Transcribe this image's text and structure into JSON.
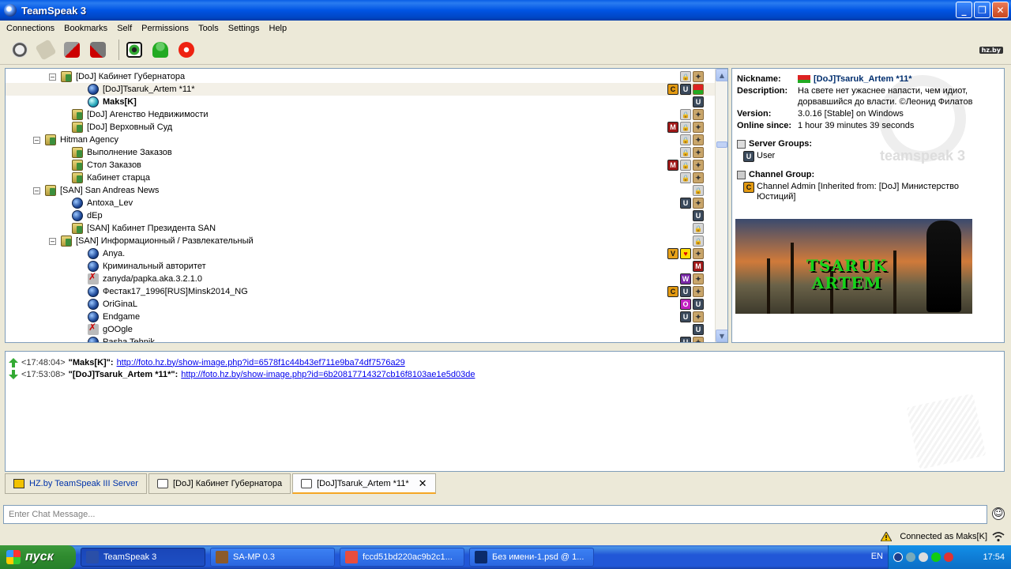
{
  "window": {
    "title": "TeamSpeak 3"
  },
  "menu": [
    "Connections",
    "Bookmarks",
    "Self",
    "Permissions",
    "Tools",
    "Settings",
    "Help"
  ],
  "toolbar": {
    "buttons": [
      "connect-icon",
      "bookmark-icon",
      "disconnect-icon",
      "disconnect-all-icon",
      "away-icon",
      "identity-icon",
      "contact-icon",
      "record-icon"
    ],
    "hz_logo": "hz.by"
  },
  "tree": [
    {
      "label": "[DoJ] Кабинет Губернатора",
      "type": "channel",
      "indent": 70,
      "expander": "–",
      "badges": [
        "lock",
        "misc"
      ]
    },
    {
      "label": "[DoJ]Tsaruk_Artem *11*",
      "type": "user",
      "indent": 104,
      "selected": true,
      "badges": [
        "C",
        "U",
        "flag"
      ]
    },
    {
      "label": "Maks[K]",
      "type": "user-talk",
      "indent": 104,
      "bold": true,
      "badges": [
        "U"
      ]
    },
    {
      "label": "[DoJ] Агенство Недвижимости",
      "type": "channel",
      "indent": 84,
      "badges": [
        "lock",
        "misc"
      ]
    },
    {
      "label": "[DoJ] Верховный Суд",
      "type": "channel",
      "indent": 84,
      "badges": [
        "M",
        "lock",
        "misc"
      ]
    },
    {
      "label": "Hitman Agency",
      "type": "channel",
      "indent": 50,
      "expander": "–",
      "badges": [
        "lock",
        "misc"
      ]
    },
    {
      "label": "Выполнение Заказов",
      "type": "channel",
      "indent": 84,
      "badges": [
        "lock",
        "misc"
      ]
    },
    {
      "label": "Стол Заказов",
      "type": "channel",
      "indent": 84,
      "badges": [
        "M",
        "lock",
        "misc"
      ]
    },
    {
      "label": "Кабинет старца",
      "type": "channel",
      "indent": 84,
      "badges": [
        "lock",
        "misc"
      ]
    },
    {
      "label": "[SAN] San Andreas News",
      "type": "channel",
      "indent": 50,
      "expander": "–",
      "badges": [
        "lock"
      ]
    },
    {
      "label": "Antoxa_Lev",
      "type": "user",
      "indent": 84,
      "badges": [
        "U",
        "misc"
      ]
    },
    {
      "label": "dEp",
      "type": "user",
      "indent": 84,
      "badges": [
        "U"
      ]
    },
    {
      "label": "[SAN] Кабинет Президента SAN",
      "type": "channel",
      "indent": 84,
      "badges": [
        "lock"
      ]
    },
    {
      "label": "[SAN] Информационный / Развлекательный",
      "type": "channel",
      "indent": 70,
      "expander": "–",
      "badges": [
        "lock"
      ]
    },
    {
      "label": "Anya.",
      "type": "user",
      "indent": 104,
      "badges": [
        "V",
        "heart",
        "misc"
      ]
    },
    {
      "label": "Криминальный авторитет",
      "type": "user",
      "indent": 104,
      "badges": [
        "M"
      ]
    },
    {
      "label": "zanyda/papka.aka.3.2.1.0",
      "type": "away",
      "indent": 104,
      "badges": [
        "W",
        "misc"
      ]
    },
    {
      "label": "Фестак17_1996[RUS]Minsk2014_NG",
      "type": "user",
      "indent": 104,
      "badges": [
        "C",
        "U",
        "misc"
      ]
    },
    {
      "label": "OriGinaL",
      "type": "user",
      "indent": 104,
      "badges": [
        "O",
        "U"
      ]
    },
    {
      "label": "Endgame",
      "type": "user",
      "indent": 104,
      "badges": [
        "U",
        "misc"
      ]
    },
    {
      "label": "gOOgle",
      "type": "away",
      "indent": 104,
      "badges": [
        "U"
      ]
    },
    {
      "label": "Pasha Tehnik",
      "type": "user",
      "indent": 104,
      "badges": [
        "U",
        "misc"
      ]
    }
  ],
  "info": {
    "nickname_label": "Nickname:",
    "nickname": "[DoJ]Tsaruk_Artem *11*",
    "description_label": "Description:",
    "description": "На свете нет ужаснее напасти, чем идиот, дорвавшийся до власти. ©Леонид Филатов",
    "version_label": "Version:",
    "version": "3.0.16 [Stable] on Windows",
    "online_label": "Online since:",
    "online": "1 hour 39 minutes 39 seconds",
    "server_groups_label": "Server Groups:",
    "server_group": "User",
    "channel_group_label": "Channel Group:",
    "channel_group": "Channel Admin [Inherited from: [DoJ] Министерство Юстиций]",
    "watermark": "teamspeak 3",
    "avatar_text_1": "TSARUK",
    "avatar_text_2": "ARTEM"
  },
  "chat": [
    {
      "time": "<17:48:04>",
      "name": "\"Maks[K]\":",
      "link": "http://foto.hz.by/show-image.php?id=6578f1c44b43ef711e9ba74df7576a29",
      "dir": "up"
    },
    {
      "time": "<17:53:08>",
      "name": "\"[DoJ]Tsaruk_Artem *11*\":",
      "link": "http://foto.hz.by/show-image.php?id=6b20817714327cb16f8103ae1e5d03de",
      "dir": "down"
    }
  ],
  "tabs": [
    {
      "label": "HZ.by TeamSpeak III Server",
      "kind": "server"
    },
    {
      "label": "[DoJ] Кабинет Губернатора",
      "kind": "channel"
    },
    {
      "label": "[DoJ]Tsaruk_Artem *11*",
      "kind": "private",
      "active": true
    }
  ],
  "chat_input": {
    "placeholder": "Enter Chat Message..."
  },
  "status": {
    "connected": "Connected as Maks[K]"
  },
  "taskbar": {
    "start": "пуск",
    "tasks": [
      {
        "label": "TeamSpeak 3",
        "active": true,
        "color": "#2a4fa8"
      },
      {
        "label": "SA-MP 0.3",
        "active": false,
        "color": "#8b5a2b"
      },
      {
        "label": "fccd51bd220ac9b2c1...",
        "active": false,
        "color": "#e84d3d"
      },
      {
        "label": "Без имени-1.psd @ 1...",
        "active": false,
        "color": "#0b2b6b"
      }
    ],
    "lang": "EN",
    "clock": "17:54"
  },
  "colors": {
    "accent": "#0054e3",
    "link": "#0000ee",
    "tab_active": "#f5a624"
  }
}
